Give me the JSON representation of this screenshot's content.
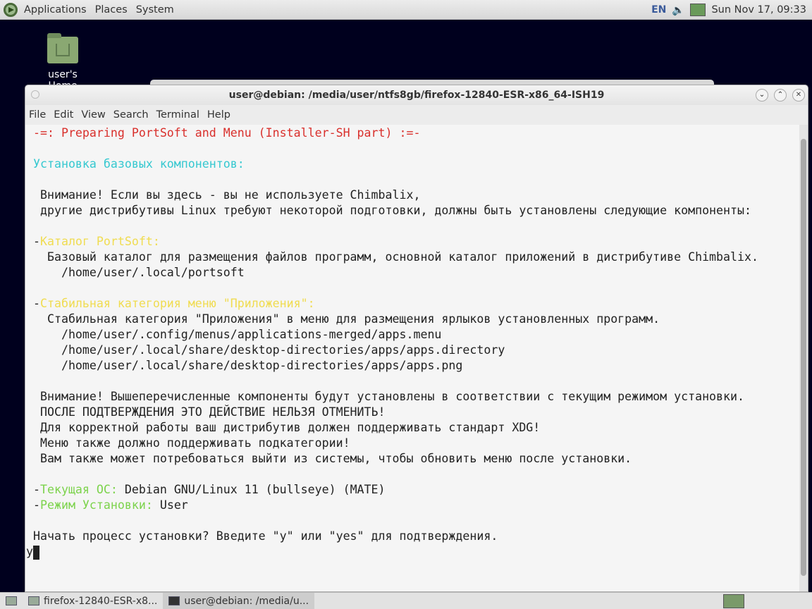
{
  "top_panel": {
    "menus": [
      "Applications",
      "Places",
      "System"
    ],
    "keyboard_layout": "EN",
    "clock": "Sun Nov 17, 09:33"
  },
  "desktop": {
    "icon_label": "user's Home"
  },
  "window": {
    "title": "user@debian: /media/user/ntfs8gb/firefox-12840-ESR-x86_64-ISH19",
    "menu": [
      "File",
      "Edit",
      "View",
      "Search",
      "Terminal",
      "Help"
    ]
  },
  "colors": {
    "red": "#d9302c",
    "cyan": "#35c8d0",
    "yellow": "#f0dc50",
    "green": "#7cd34c",
    "text": "#222222"
  },
  "terminal": {
    "lines": [
      [
        {
          "t": " -=: Preparing PortSoft and Menu (Installer-SH part) :=-",
          "c": "red"
        }
      ],
      [],
      [
        {
          "t": " Установка базовых компонентов:",
          "c": "cyan"
        }
      ],
      [],
      [
        {
          "t": "  Внимание! Если вы здесь - вы не используете Chimbalix,"
        }
      ],
      [
        {
          "t": "  другие дистрибутивы Linux требуют некоторой подготовки, должны быть установлены следующие компоненты:"
        }
      ],
      [],
      [
        {
          "t": " -"
        },
        {
          "t": "Каталог PortSoft:",
          "c": "yellow"
        }
      ],
      [
        {
          "t": "   Базовый каталог для размещения файлов программ, основной каталог приложений в дистрибутиве Chimbalix."
        }
      ],
      [
        {
          "t": "     /home/user/.local/portsoft"
        }
      ],
      [],
      [
        {
          "t": " -"
        },
        {
          "t": "Стабильная категория меню \"Приложения\":",
          "c": "yellow"
        }
      ],
      [
        {
          "t": "   Стабильная категория \"Приложения\" в меню для размещения ярлыков установленных программ."
        }
      ],
      [
        {
          "t": "     /home/user/.config/menus/applications-merged/apps.menu"
        }
      ],
      [
        {
          "t": "     /home/user/.local/share/desktop-directories/apps/apps.directory"
        }
      ],
      [
        {
          "t": "     /home/user/.local/share/desktop-directories/apps/apps.png"
        }
      ],
      [],
      [
        {
          "t": "  Внимание! Вышеперечисленные компоненты будут установлены в соответствии с текущим режимом установки."
        }
      ],
      [
        {
          "t": "  ПОСЛЕ ПОДТВЕРЖДЕНИЯ ЭТО ДЕЙСТВИЕ НЕЛЬЗЯ ОТМЕНИТЬ!"
        }
      ],
      [
        {
          "t": "  Для корректной работы ваш дистрибутив должен поддерживать стандарт XDG!"
        }
      ],
      [
        {
          "t": "  Меню также должно поддерживать подкатегории!"
        }
      ],
      [
        {
          "t": "  Вам также может потребоваться выйти из системы, чтобы обновить меню после установки."
        }
      ],
      [],
      [
        {
          "t": " -"
        },
        {
          "t": "Текущая ОС:",
          "c": "green"
        },
        {
          "t": " Debian GNU/Linux 11 (bullseye) (MATE)"
        }
      ],
      [
        {
          "t": " -"
        },
        {
          "t": "Режим Установки:",
          "c": "green"
        },
        {
          "t": " User"
        }
      ],
      [],
      [
        {
          "t": " Начать процесс установки? Введите \"y\" или \"yes\" для подтверждения."
        }
      ]
    ],
    "input": "y"
  },
  "taskbar": {
    "items": [
      "firefox-12840-ESR-x8...",
      "user@debian: /media/u..."
    ]
  }
}
